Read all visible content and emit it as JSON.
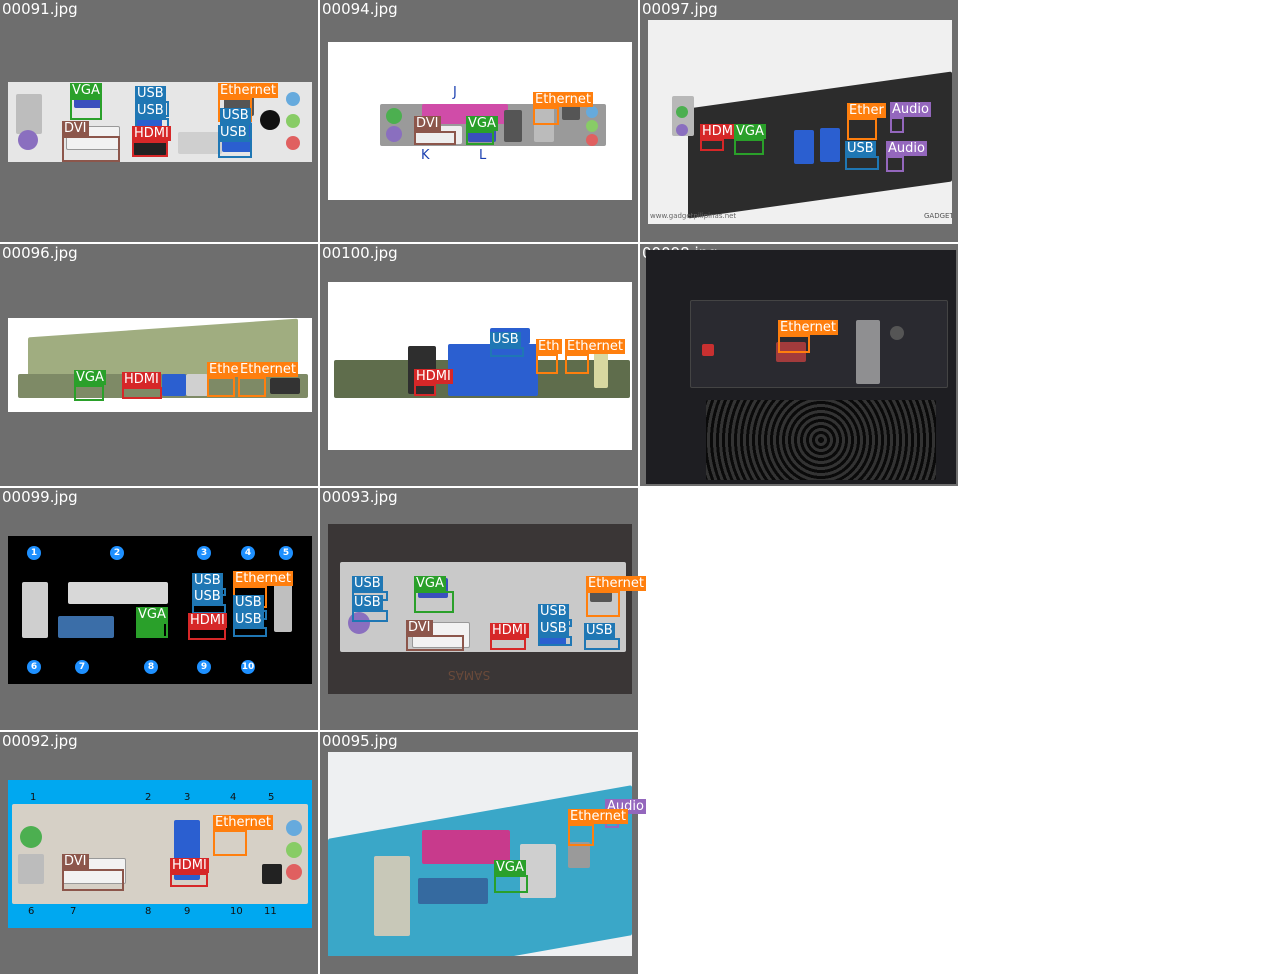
{
  "colors": {
    "vga": "#2aa02a",
    "usb": "#1f77b4",
    "ethernet": "#ff7f0e",
    "hdmi": "#d62728",
    "dvi": "#8c564b",
    "audio": "#9467bd",
    "tile_bg": "#6e6e6e"
  },
  "tiles": [
    {
      "file": "00091.jpg",
      "labels": [
        "VGA",
        "USB",
        "USB",
        "Ethernet",
        "USB",
        "DVI",
        "HDMI",
        "USB"
      ]
    },
    {
      "file": "00094.jpg",
      "labels": [
        "Ethernet",
        "DVI",
        "VGA"
      ],
      "letters": [
        "J",
        "K",
        "L"
      ]
    },
    {
      "file": "00097.jpg",
      "labels": [
        "Ether",
        "Audio",
        "HDM",
        "VGA",
        "USB",
        "Audio"
      ],
      "watermark": "www.gadgetpilipinas.net",
      "logo": "GADGET"
    },
    {
      "file": "00096.jpg",
      "labels": [
        "VGA",
        "HDMI",
        "Ethe",
        "Ethernet"
      ]
    },
    {
      "file": "00100.jpg",
      "labels": [
        "USB",
        "Eth",
        "Ethernet",
        "HDMI"
      ]
    },
    {
      "file": "00098.jpg",
      "labels": [
        "Ethernet"
      ]
    },
    {
      "file": "00099.jpg",
      "labels": [
        "USB",
        "USB",
        "Ethernet",
        "USB",
        "USB",
        "VGA",
        "HDMI"
      ],
      "numbers": [
        "1",
        "2",
        "3",
        "4",
        "5",
        "6",
        "7",
        "8",
        "9",
        "10"
      ]
    },
    {
      "file": "00093.jpg",
      "labels": [
        "USB",
        "USB",
        "VGA",
        "Ethernet",
        "USB",
        "USB",
        "DVI",
        "HDMI",
        "USB"
      ],
      "case_text": "SAMAS"
    },
    {
      "file": "00092.jpg",
      "labels": [
        "Ethernet",
        "DVI",
        "HDMI"
      ],
      "numbers": [
        "1",
        "2",
        "3",
        "4",
        "5",
        "6",
        "7",
        "8",
        "9",
        "10",
        "11"
      ]
    },
    {
      "file": "00095.jpg",
      "labels": [
        "Audio",
        "Ethernet",
        "VGA"
      ]
    }
  ]
}
